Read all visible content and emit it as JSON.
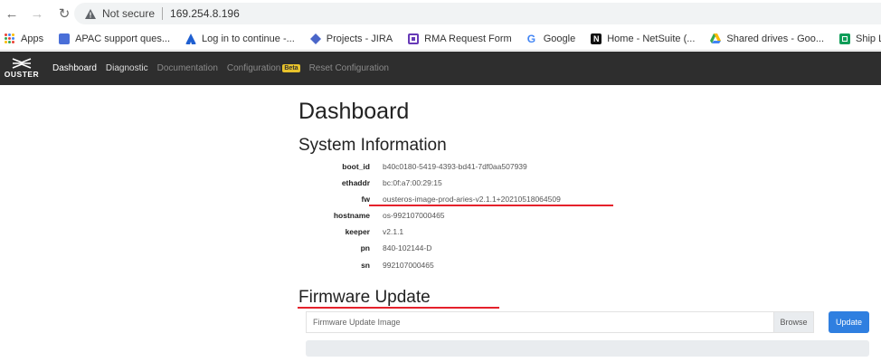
{
  "browser": {
    "security_label": "Not secure",
    "url": "169.254.8.196",
    "bookmarks": [
      {
        "label": "Apps",
        "icon": "apps-grid-icon"
      },
      {
        "label": "APAC support ques...",
        "icon": "doc-icon",
        "color": "#4a6fd8"
      },
      {
        "label": "Log in to continue -...",
        "icon": "atlassian-icon",
        "color": "#1f5fd1"
      },
      {
        "label": "Projects - JIRA",
        "icon": "jira-icon",
        "color": "#4a66c9"
      },
      {
        "label": "RMA Request Form",
        "icon": "form-icon",
        "color": "#673ab7"
      },
      {
        "label": "Google",
        "icon": "google-icon",
        "color": "#4285f4"
      },
      {
        "label": "Home - NetSuite (...",
        "icon": "netsuite-icon",
        "color": "#111111"
      },
      {
        "label": "Shared drives - Goo...",
        "icon": "drive-icon",
        "color": "#fbbc04"
      },
      {
        "label": "Ship List - Googl",
        "icon": "sheets-icon",
        "color": "#0f9d58"
      }
    ]
  },
  "navbar": {
    "logo_text": "OUSTER",
    "links": [
      {
        "label": "Dashboard",
        "state": "active"
      },
      {
        "label": "Diagnostic",
        "state": "bright"
      },
      {
        "label": "Documentation",
        "state": "dim"
      },
      {
        "label": "Configuration",
        "state": "dim",
        "badge": "Beta"
      },
      {
        "label": "Reset Configuration",
        "state": "dim"
      }
    ]
  },
  "page": {
    "title": "Dashboard",
    "system_info_title": "System Information",
    "system_info": [
      {
        "key": "boot_id",
        "value": "b40c0180-5419-4393-bd41-7df0aa507939"
      },
      {
        "key": "ethaddr",
        "value": "bc:0f:a7:00:29:15"
      },
      {
        "key": "fw",
        "value": "ousteros-image-prod-aries-v2.1.1+20210518064509"
      },
      {
        "key": "hostname",
        "value": "os-992107000465"
      },
      {
        "key": "keeper",
        "value": "v2.1.1"
      },
      {
        "key": "pn",
        "value": "840-102144-D"
      },
      {
        "key": "sn",
        "value": "992107000465"
      }
    ],
    "firmware_title": "Firmware Update",
    "firmware_placeholder": "Firmware Update Image",
    "browse_label": "Browse",
    "update_label": "Update",
    "progress": 0
  },
  "colors": {
    "navbar_bg": "#2e2e2e",
    "accent_blue": "#2f7fe0",
    "annotation_red": "#e5212b",
    "beta_badge": "#e8c22b"
  }
}
